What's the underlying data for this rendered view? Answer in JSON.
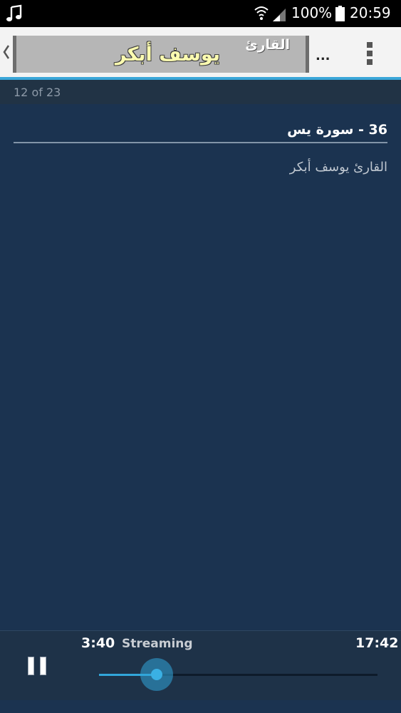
{
  "status_bar": {
    "battery": "100%",
    "time": "20:59",
    "icons": [
      "music-note-icon",
      "wifi-icon",
      "signal-icon",
      "battery-icon"
    ]
  },
  "action_bar": {
    "banner_top": "القارئ",
    "banner_main": "يوسف أبكر",
    "overflow_label": "...",
    "icons": [
      "chevron-left-icon",
      "more-vertical-icon"
    ]
  },
  "list": {
    "counter": "12 of 23"
  },
  "track": {
    "title": "36 - سورة يس",
    "subtitle": "القارئ يوسف أبكر"
  },
  "player": {
    "current_time": "3:40",
    "status": "Streaming",
    "total_time": "17:42",
    "progress": 0.207,
    "icons": [
      "pause-icon"
    ]
  },
  "colors": {
    "background": "#1b3350",
    "accent": "#32a6da",
    "banner_text": "#fbfbb0"
  }
}
